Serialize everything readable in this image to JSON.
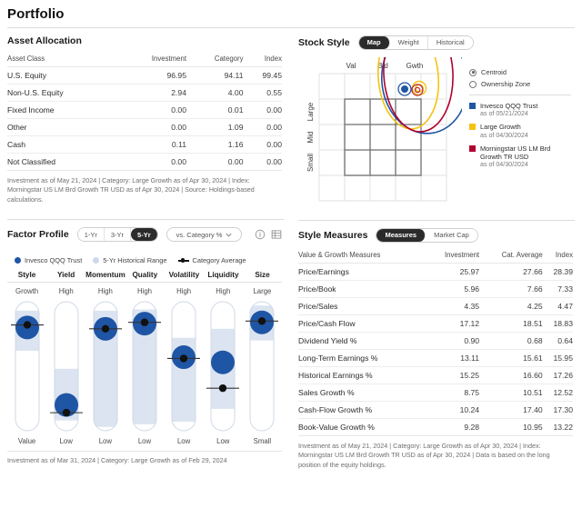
{
  "page": {
    "title": "Portfolio"
  },
  "asset_allocation": {
    "title": "Asset Allocation",
    "columns": [
      "Asset Class",
      "Investment",
      "Category",
      "Index"
    ],
    "rows": [
      {
        "label": "U.S. Equity",
        "investment": "96.95",
        "category": "94.11",
        "index": "99.45"
      },
      {
        "label": "Non-U.S. Equity",
        "investment": "2.94",
        "category": "4.00",
        "index": "0.55"
      },
      {
        "label": "Fixed Income",
        "investment": "0.00",
        "category": "0.01",
        "index": "0.00"
      },
      {
        "label": "Other",
        "investment": "0.00",
        "category": "1.09",
        "index": "0.00"
      },
      {
        "label": "Cash",
        "investment": "0.11",
        "category": "1.16",
        "index": "0.00"
      },
      {
        "label": "Not Classified",
        "investment": "0.00",
        "category": "0.00",
        "index": "0.00"
      }
    ],
    "footnote": "Investment as of May 21, 2024 | Category: Large Growth as of Apr 30, 2024 | Index: Morningstar US LM Brd Growth TR USD as of Apr 30, 2024 | Source: Holdings-based calculations."
  },
  "stock_style": {
    "title": "Stock Style",
    "tabs": [
      {
        "label": "Map",
        "active": true
      },
      {
        "label": "Weight",
        "active": false
      },
      {
        "label": "Historical",
        "active": false
      }
    ],
    "x_labels": [
      "Val",
      "Bld",
      "Gwth"
    ],
    "y_labels": [
      "Large",
      "Mid",
      "Small"
    ],
    "legend_markers": [
      {
        "label": "Centroid",
        "marker": "centroid-icon"
      },
      {
        "label": "Ownership Zone",
        "marker": "ownership-zone-icon"
      }
    ],
    "legend_series": [
      {
        "name": "Invesco QQQ Trust",
        "as_of": "as of 05/21/2024",
        "color": "#1f55a5"
      },
      {
        "name": "Large Growth",
        "as_of": "as of 04/30/2024",
        "color": "#f5c211"
      },
      {
        "name": "Morningstar US LM Brd Growth TR USD",
        "as_of": "as of 04/30/2024",
        "color": "#b00030"
      }
    ]
  },
  "factor_profile": {
    "title": "Factor Profile",
    "period_tabs": [
      {
        "label": "1-Yr",
        "active": false
      },
      {
        "label": "3-Yr",
        "active": false
      },
      {
        "label": "5-Yr",
        "active": true
      }
    ],
    "compare_dropdown": "vs. Category %",
    "legend": [
      {
        "label": "Invesco QQQ Trust",
        "marker": "blue-dot",
        "color": "#1f55a5"
      },
      {
        "label": "5-Yr Historical Range",
        "marker": "light-dot",
        "color": "#ccd9ec"
      },
      {
        "label": "Category Average",
        "marker": "cat-avg-line",
        "color": "#111111"
      }
    ],
    "factors": [
      {
        "name": "Style",
        "top": "Growth",
        "bottom": "Value",
        "value": 0.8,
        "range_top": 0.93,
        "range_bottom": 0.62,
        "cat_avg": 0.82
      },
      {
        "name": "Yield",
        "top": "High",
        "bottom": "Low",
        "value": 0.2,
        "range_top": 0.48,
        "range_bottom": 0.08,
        "cat_avg": 0.14
      },
      {
        "name": "Momentum",
        "top": "High",
        "bottom": "Low",
        "value": 0.79,
        "range_top": 0.93,
        "range_bottom": 0.03,
        "cat_avg": 0.79
      },
      {
        "name": "Quality",
        "top": "High",
        "bottom": "Low",
        "value": 0.83,
        "range_top": 0.94,
        "range_bottom": 0.05,
        "cat_avg": 0.84
      },
      {
        "name": "Volatility",
        "top": "High",
        "bottom": "Low",
        "value": 0.57,
        "range_top": 0.72,
        "range_bottom": 0.07,
        "cat_avg": 0.56
      },
      {
        "name": "Liquidity",
        "top": "High",
        "bottom": "Low",
        "value": 0.53,
        "range_top": 0.79,
        "range_bottom": 0.17,
        "cat_avg": 0.33
      },
      {
        "name": "Size",
        "top": "Large",
        "bottom": "Small",
        "value": 0.84,
        "range_top": 0.97,
        "range_bottom": 0.7,
        "cat_avg": 0.85
      }
    ],
    "footnote": "Investment as of Mar 31, 2024 | Category: Large Growth as of Feb 29, 2024"
  },
  "style_measures": {
    "title": "Style Measures",
    "tabs": [
      {
        "label": "Measures",
        "active": true
      },
      {
        "label": "Market Cap",
        "active": false
      }
    ],
    "columns": [
      "Value & Growth Measures",
      "Investment",
      "Cat. Average",
      "Index"
    ],
    "rows": [
      {
        "label": "Price/Earnings",
        "investment": "25.97",
        "cat_average": "27.66",
        "index": "28.39"
      },
      {
        "label": "Price/Book",
        "investment": "5.96",
        "cat_average": "7.66",
        "index": "7.33"
      },
      {
        "label": "Price/Sales",
        "investment": "4.35",
        "cat_average": "4.25",
        "index": "4.47"
      },
      {
        "label": "Price/Cash Flow",
        "investment": "17.12",
        "cat_average": "18.51",
        "index": "18.83"
      },
      {
        "label": "Dividend Yield %",
        "investment": "0.90",
        "cat_average": "0.68",
        "index": "0.64"
      },
      {
        "label": "Long-Term Earnings %",
        "investment": "13.11",
        "cat_average": "15.61",
        "index": "15.95"
      },
      {
        "label": "Historical Earnings %",
        "investment": "15.25",
        "cat_average": "16.60",
        "index": "17.26"
      },
      {
        "label": "Sales Growth %",
        "investment": "8.75",
        "cat_average": "10.51",
        "index": "12.52"
      },
      {
        "label": "Cash-Flow Growth %",
        "investment": "10.24",
        "cat_average": "17.40",
        "index": "17.30"
      },
      {
        "label": "Book-Value Growth %",
        "investment": "9.28",
        "cat_average": "10.95",
        "index": "13.22"
      }
    ],
    "footnote": "Investment as of May 21, 2024 | Category: Large Growth as of Apr 30, 2024 | Index: Morningstar US LM Brd Growth TR USD as of Apr 30, 2024 | Data is based on the long position of the equity holdings."
  },
  "icons": {
    "info": "info-icon",
    "table": "table-view-icon",
    "chevron": "chevron-down-icon"
  }
}
